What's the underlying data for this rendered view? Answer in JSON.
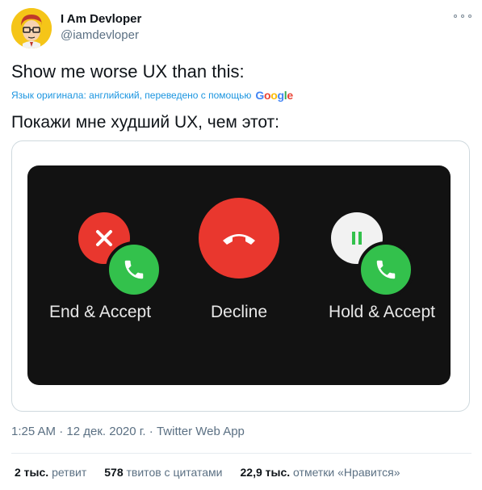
{
  "author": {
    "display_name": "I Am Devloper",
    "handle": "@iamdevloper"
  },
  "tweet": {
    "text": "Show me worse UX than this:",
    "translation_note": "Язык оригинала: английский, переведено с помощью",
    "translation_provider": "Google",
    "translated_text": "Покажи мне худший UX, чем этот:"
  },
  "media": {
    "options": [
      {
        "label": "End & Accept",
        "secondary_icon": "close-icon",
        "primary_icon": "phone-icon"
      },
      {
        "label": "Decline",
        "primary_icon": "hangup-icon"
      },
      {
        "label": "Hold & Accept",
        "secondary_icon": "pause-icon",
        "primary_icon": "phone-icon"
      }
    ],
    "colors": {
      "decline": "#e9372e",
      "accept": "#33c14c",
      "hold": "#f2f2f2",
      "screen": "#121212"
    }
  },
  "meta": {
    "time": "1:25 AM",
    "separator": "·",
    "date": "12 дек. 2020 г.",
    "source": "Twitter Web App"
  },
  "stats": {
    "retweets_count": "2 тыс.",
    "retweets_label": "ретвит",
    "quotes_count": "578",
    "quotes_label": "твитов с цитатами",
    "likes_count": "22,9 тыс.",
    "likes_label": "отметки «Нравится»"
  }
}
